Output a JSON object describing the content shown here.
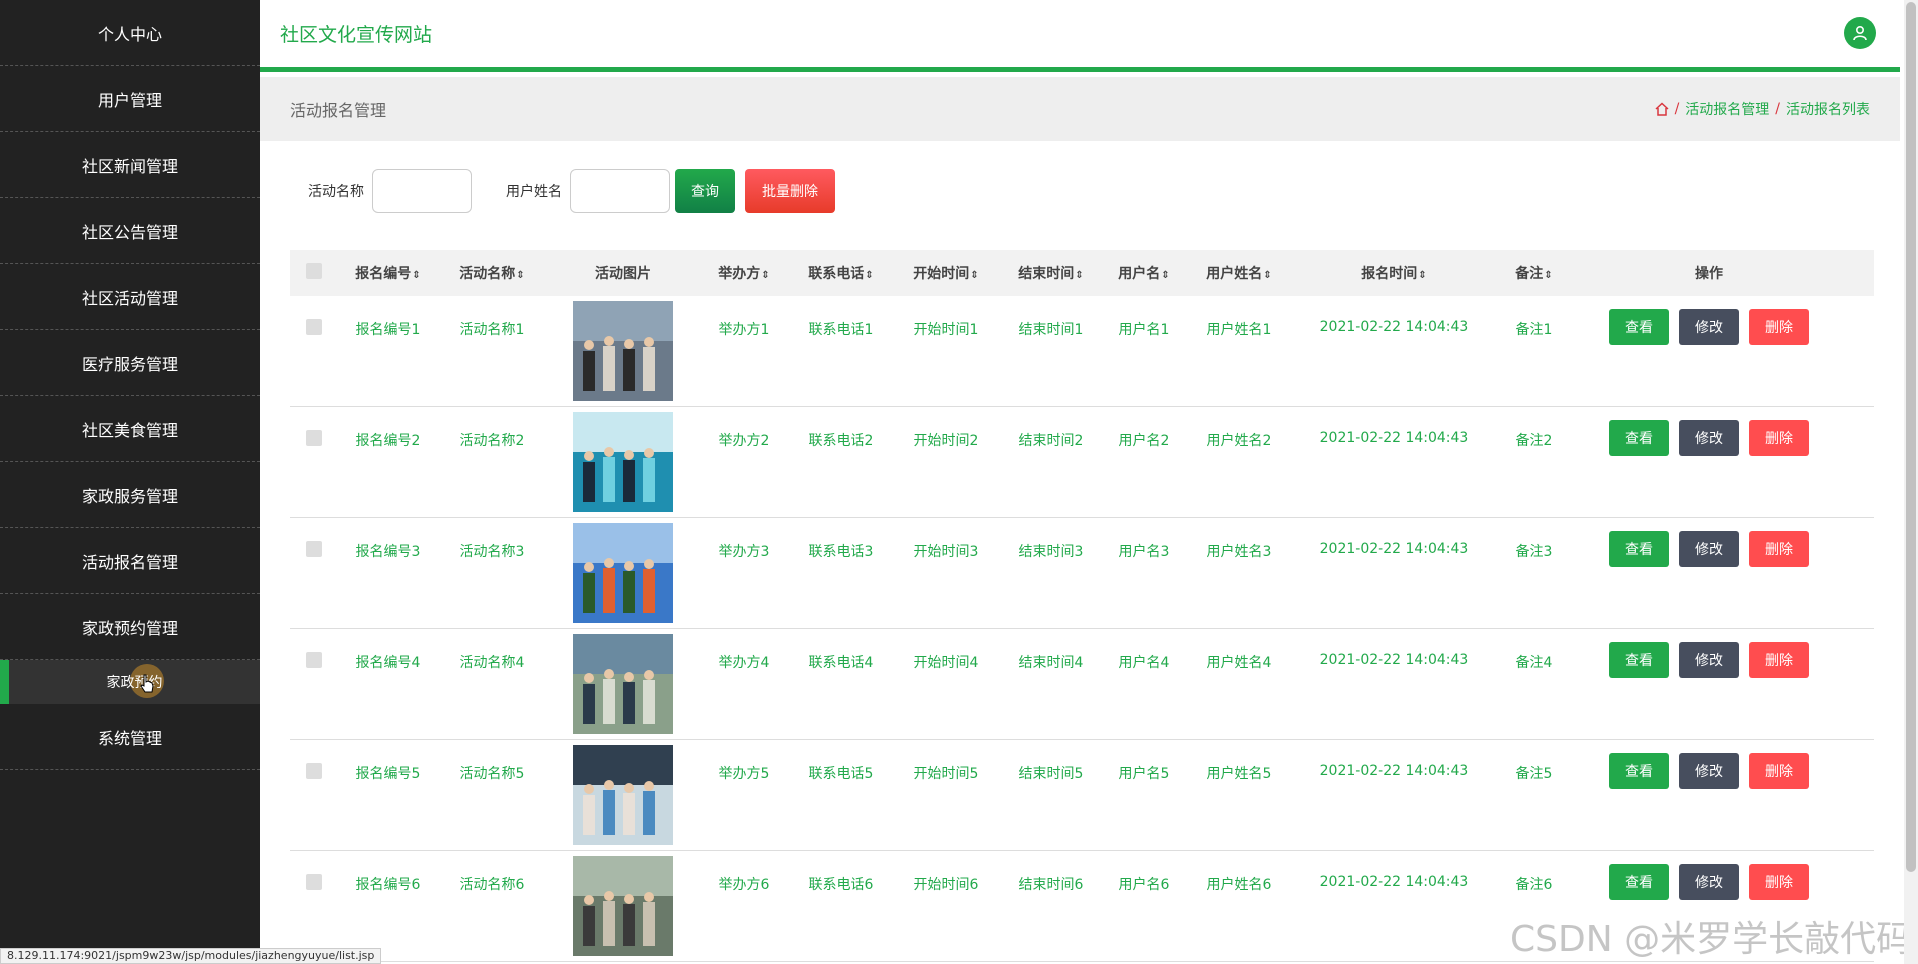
{
  "sidebar": {
    "items": [
      {
        "label": "个人中心"
      },
      {
        "label": "用户管理"
      },
      {
        "label": "社区新闻管理"
      },
      {
        "label": "社区公告管理"
      },
      {
        "label": "社区活动管理"
      },
      {
        "label": "医疗服务管理"
      },
      {
        "label": "社区美食管理"
      },
      {
        "label": "家政服务管理"
      },
      {
        "label": "活动报名管理"
      },
      {
        "label": "家政预约管理"
      }
    ],
    "active_submenu": "家政预约",
    "last_item": "系统管理"
  },
  "header": {
    "title": "社区文化宣传网站"
  },
  "subheader": {
    "title": "活动报名管理",
    "breadcrumb": [
      "活动报名管理",
      "活动报名列表"
    ]
  },
  "search": {
    "label1": "活动名称",
    "label2": "用户姓名",
    "query_button": "查询",
    "batch_delete_button": "批量删除"
  },
  "table": {
    "columns": [
      "报名编号",
      "活动名称",
      "活动图片",
      "举办方",
      "联系电话",
      "开始时间",
      "结束时间",
      "用户名",
      "用户姓名",
      "报名时间",
      "备注",
      "操作"
    ],
    "rows": [
      {
        "no": "报名编号1",
        "name": "活动名称1",
        "host": "举办方1",
        "phone": "联系电话1",
        "start": "开始时间1",
        "end": "结束时间1",
        "user": "用户名1",
        "realname": "用户姓名1",
        "time": "2021-02-22 14:04:43",
        "note": "备注1"
      },
      {
        "no": "报名编号2",
        "name": "活动名称2",
        "host": "举办方2",
        "phone": "联系电话2",
        "start": "开始时间2",
        "end": "结束时间2",
        "user": "用户名2",
        "realname": "用户姓名2",
        "time": "2021-02-22 14:04:43",
        "note": "备注2"
      },
      {
        "no": "报名编号3",
        "name": "活动名称3",
        "host": "举办方3",
        "phone": "联系电话3",
        "start": "开始时间3",
        "end": "结束时间3",
        "user": "用户名3",
        "realname": "用户姓名3",
        "time": "2021-02-22 14:04:43",
        "note": "备注3"
      },
      {
        "no": "报名编号4",
        "name": "活动名称4",
        "host": "举办方4",
        "phone": "联系电话4",
        "start": "开始时间4",
        "end": "结束时间4",
        "user": "用户名4",
        "realname": "用户姓名4",
        "time": "2021-02-22 14:04:43",
        "note": "备注4"
      },
      {
        "no": "报名编号5",
        "name": "活动名称5",
        "host": "举办方5",
        "phone": "联系电话5",
        "start": "开始时间5",
        "end": "结束时间5",
        "user": "用户名5",
        "realname": "用户姓名5",
        "time": "2021-02-22 14:04:43",
        "note": "备注5"
      },
      {
        "no": "报名编号6",
        "name": "活动名称6",
        "host": "举办方6",
        "phone": "联系电话6",
        "start": "开始时间6",
        "end": "结束时间6",
        "user": "用户名6",
        "realname": "用户姓名6",
        "time": "2021-02-22 14:04:43",
        "note": "备注6"
      }
    ],
    "actions": {
      "view": "查看",
      "edit": "修改",
      "delete": "删除"
    }
  },
  "status_bar_url": "8.129.11.174:9021/jspm9w23w/jsp/modules/jiazhengyuyue/list.jsp",
  "watermark": "CSDN @米罗学长敲代码",
  "colors": {
    "accent": "#22a94b",
    "danger": "#ff4d4f",
    "edit": "#474e5e",
    "sidebar": "#222222"
  }
}
